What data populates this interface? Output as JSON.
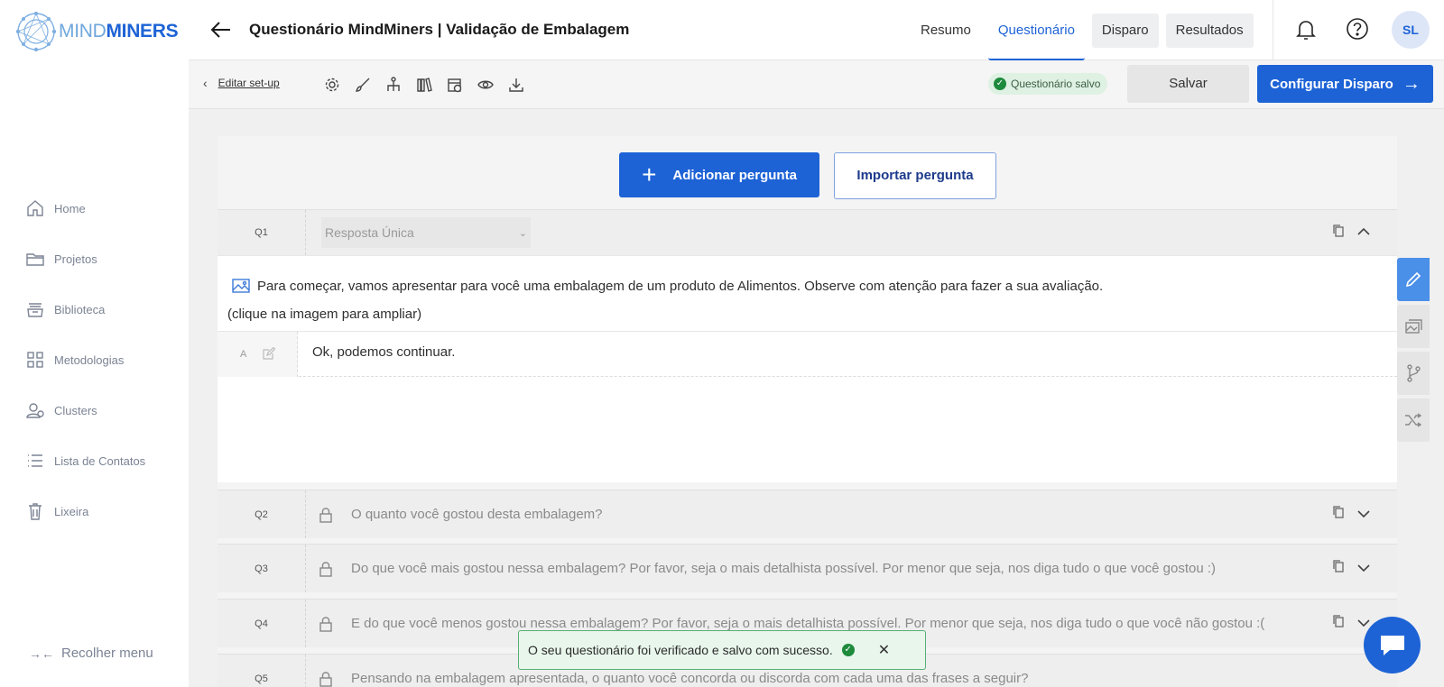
{
  "brand": {
    "logo_text_light": "MIND",
    "logo_text_bold": "MINERS"
  },
  "sidebar": {
    "items": [
      {
        "label": "Home",
        "icon": "home-icon"
      },
      {
        "label": "Projetos",
        "icon": "folder-icon"
      },
      {
        "label": "Biblioteca",
        "icon": "library-icon"
      },
      {
        "label": "Metodologias",
        "icon": "grid-icon"
      },
      {
        "label": "Clusters",
        "icon": "users-icon"
      },
      {
        "label": "Lista de Contatos",
        "icon": "list-icon"
      },
      {
        "label": "Lixeira",
        "icon": "trash-icon"
      }
    ],
    "collapse_label": "Recolher menu"
  },
  "header": {
    "title": "Questionário MindMiners | Validação de Embalagem",
    "tabs": [
      {
        "label": "Resumo",
        "state": "default"
      },
      {
        "label": "Questionário",
        "state": "active"
      },
      {
        "label": "Disparo",
        "state": "grey"
      },
      {
        "label": "Resultados",
        "state": "grey"
      }
    ],
    "avatar_initials": "SL"
  },
  "toolbar": {
    "edit_setup_label": "Editar set-up",
    "saved_badge": "Questionário salvo",
    "save_label": "Salvar",
    "config_label": "Configurar Disparo"
  },
  "main": {
    "add_question_label": "Adicionar pergunta",
    "import_question_label": "Importar pergunta",
    "q1": {
      "number": "Q1",
      "type_value": "Resposta Única",
      "intro_line1": "Para começar, vamos apresentar para você uma embalagem de um produto de Alimentos. Observe com atenção para fazer a sua avaliação.",
      "intro_line2": "(clique na imagem para ampliar)",
      "answer_letter": "A",
      "answer_text": "Ok, podemos continuar."
    },
    "questions": [
      {
        "number": "Q2",
        "text": "O quanto você gostou desta embalagem?"
      },
      {
        "number": "Q3",
        "text": "Do que você mais gostou nessa embalagem? Por favor, seja o mais detalhista possível. Por menor que seja, nos diga tudo o que você gostou :)"
      },
      {
        "number": "Q4",
        "text": "E do que você menos gostou nessa embalagem? Por favor, seja o mais detalhista possível. Por menor que seja, nos diga tudo o que você não gostou :("
      },
      {
        "number": "Q5",
        "text": "Pensando na embalagem apresentada, o quanto você concorda ou discorda com cada uma das frases a seguir?"
      }
    ]
  },
  "toast": {
    "message": "O seu questionário foi verificado e salvo com sucesso."
  },
  "colors": {
    "primary": "#1d63d6",
    "success": "#1e8a3c",
    "muted_text": "#7b8394"
  }
}
